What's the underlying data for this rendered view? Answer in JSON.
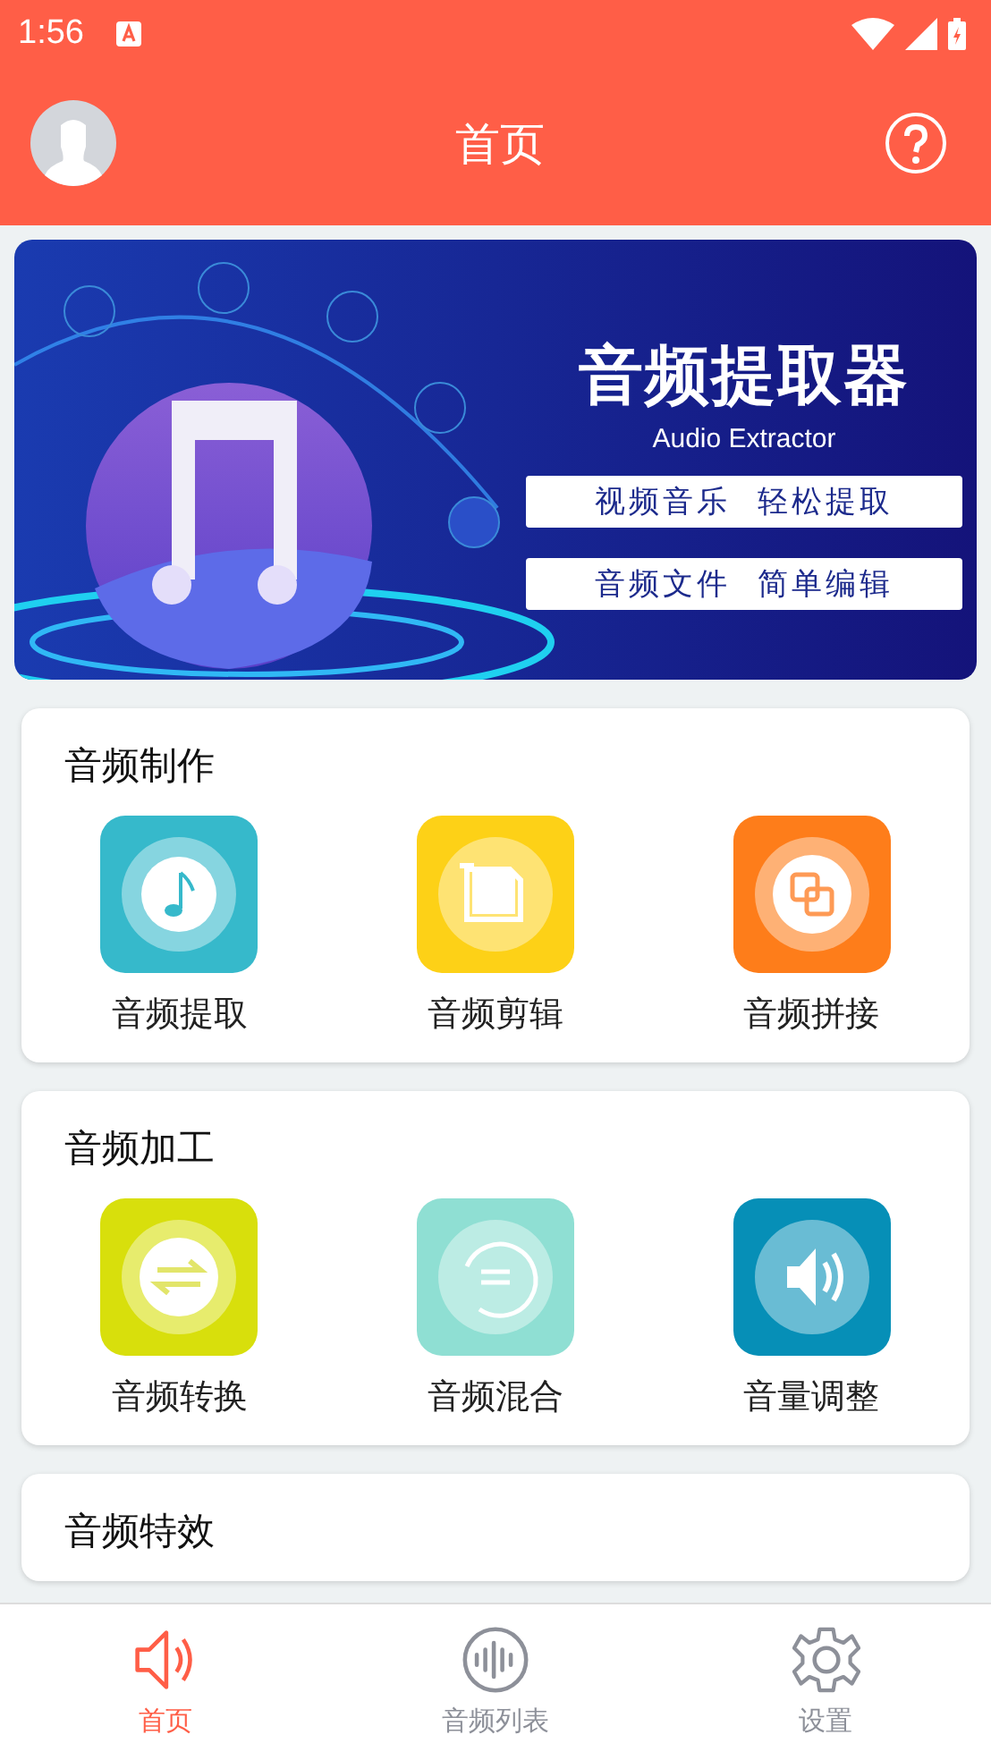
{
  "status_bar": {
    "time": "1:56"
  },
  "header": {
    "title": "首页"
  },
  "banner": {
    "title": "音频提取器",
    "subtitle": "Audio Extractor",
    "taglines": [
      "视频音乐  轻松提取",
      "音频文件  简单编辑"
    ]
  },
  "sections": [
    {
      "title": "音频制作",
      "tools": [
        {
          "label": "音频提取",
          "kind": "note",
          "color": "#36b9cb"
        },
        {
          "label": "音频剪辑",
          "kind": "crop",
          "color": "#fdd117"
        },
        {
          "label": "音频拼接",
          "kind": "overlap",
          "color": "#fe7d1a"
        }
      ]
    },
    {
      "title": "音频加工",
      "tools": [
        {
          "label": "音频转换",
          "kind": "swap",
          "color": "#d8df0c"
        },
        {
          "label": "音频混合",
          "kind": "loop",
          "color": "#8fdfd3"
        },
        {
          "label": "音量调整",
          "kind": "speaker",
          "color": "#068fb7"
        }
      ]
    },
    {
      "title": "音频特效"
    }
  ],
  "bottom_nav": [
    {
      "label": "首页",
      "kind": "speaker",
      "selected": true
    },
    {
      "label": "音频列表",
      "kind": "wave",
      "selected": false
    },
    {
      "label": "设置",
      "kind": "gear",
      "selected": false
    }
  ]
}
